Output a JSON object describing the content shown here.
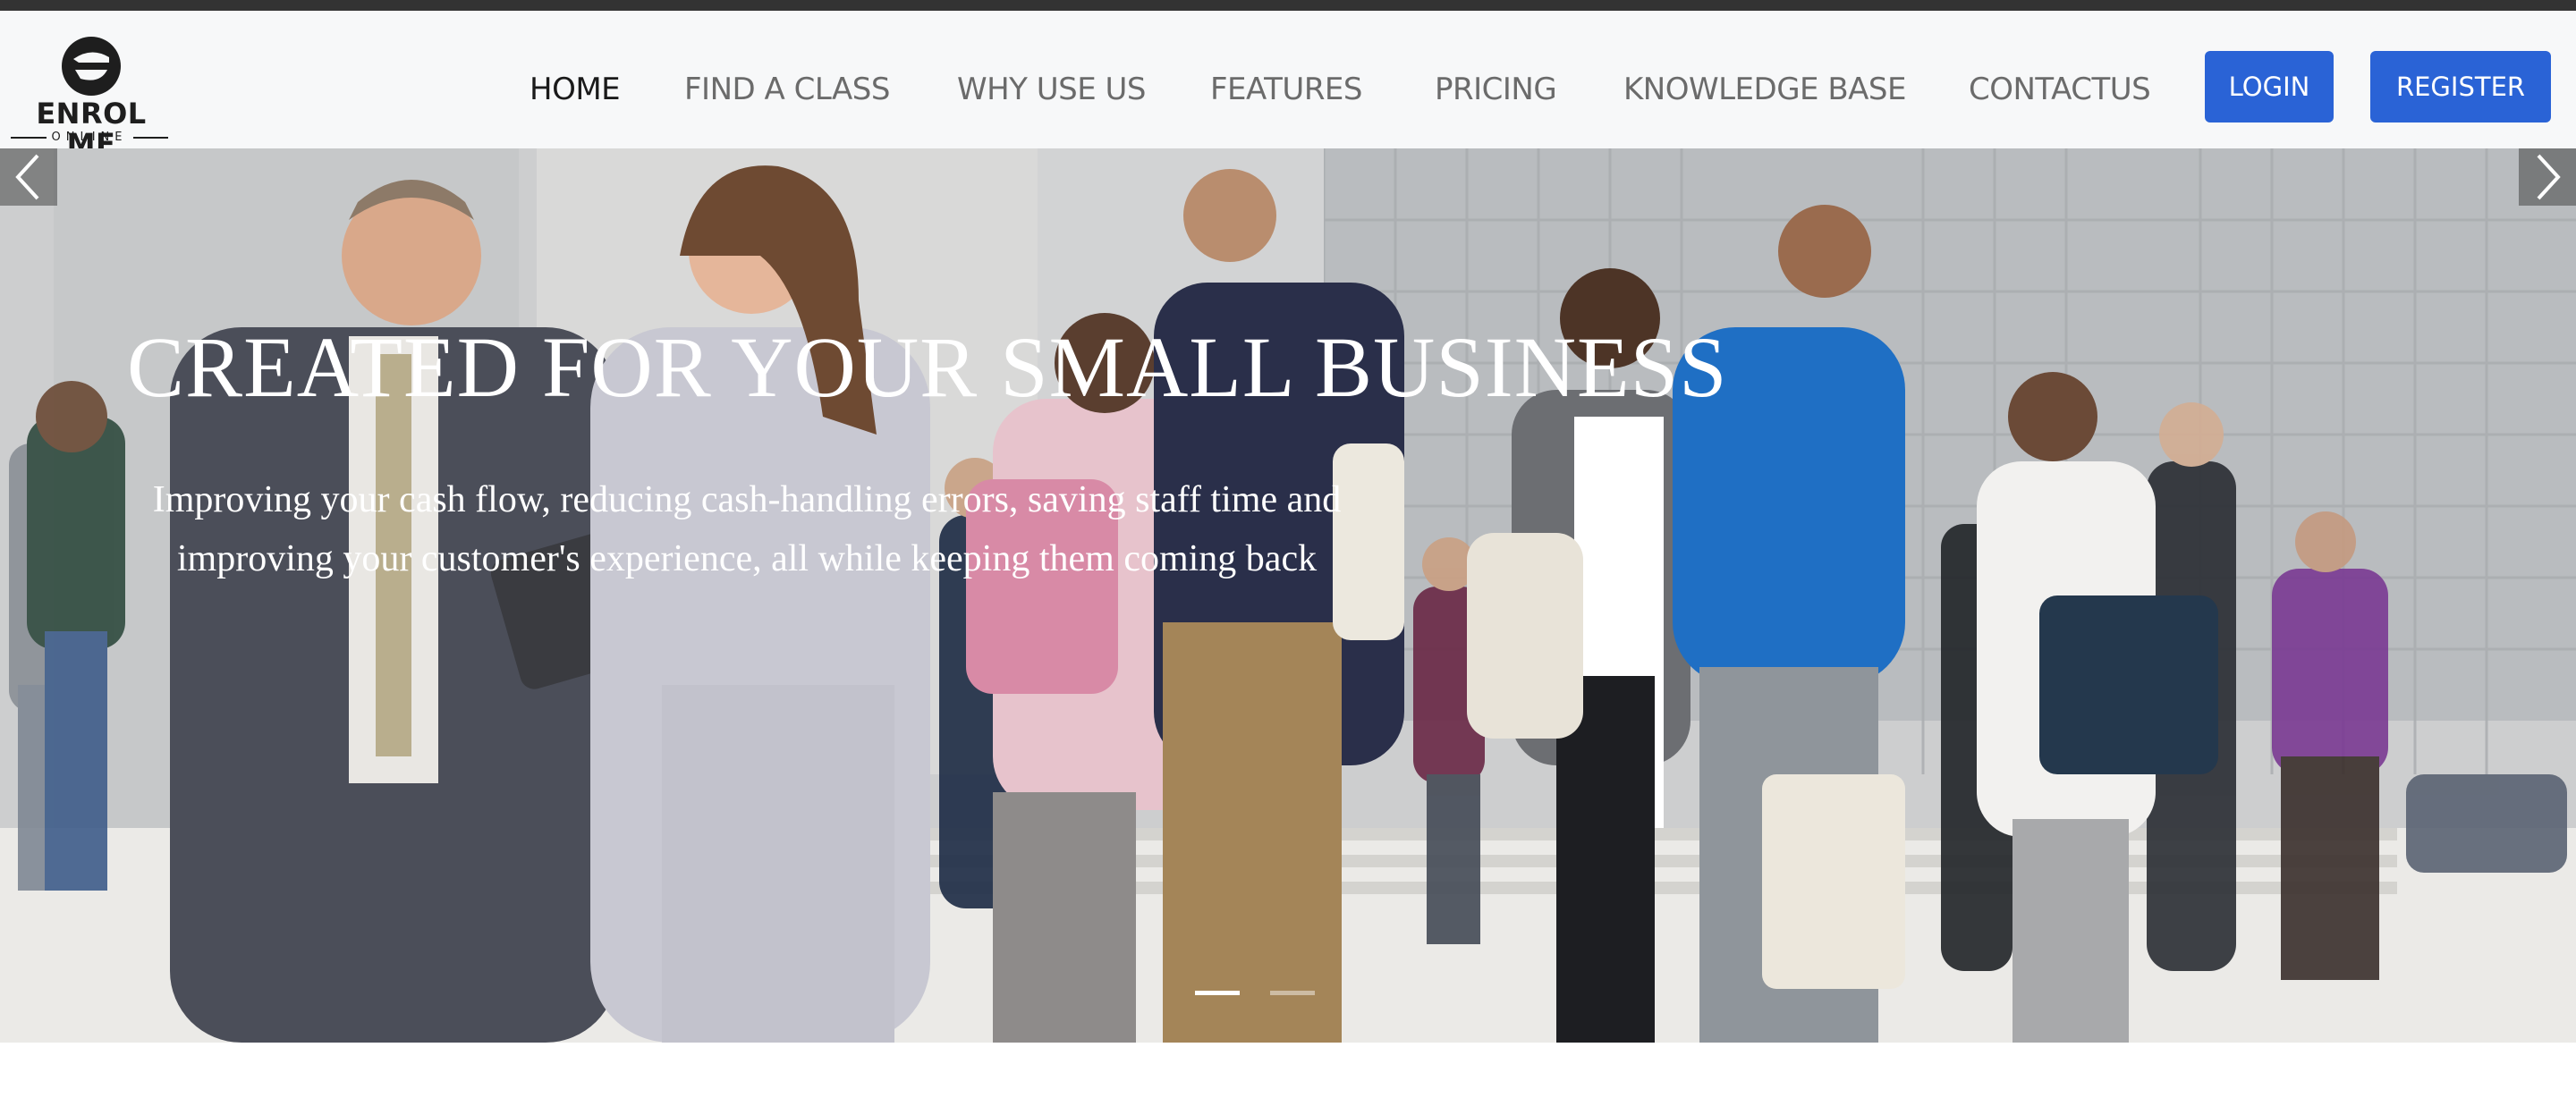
{
  "brand": {
    "name": "ENROL ME",
    "tagline": "ONLINE",
    "logo_icon": "e-monogram-icon"
  },
  "nav": {
    "items": [
      {
        "label": "HOME",
        "active": true
      },
      {
        "label": "FIND A CLASS",
        "active": false
      },
      {
        "label": "WHY USE US",
        "active": false
      },
      {
        "label": "FEATURES",
        "active": false
      },
      {
        "label": "PRICING",
        "active": false
      },
      {
        "label": "KNOWLEDGE BASE",
        "active": false
      },
      {
        "label": "CONTACTUS",
        "active": false
      }
    ],
    "login_label": "LOGIN",
    "register_label": "REGISTER"
  },
  "hero": {
    "title": "CREATED FOR YOUR SMALL BUSINESS",
    "subtitle": "Improving your cash flow, reducing cash-handling errors, saving staff time and improving your customer's experience, all while keeping them coming back",
    "prev_icon": "chevron-left-icon",
    "next_icon": "chevron-right-icon",
    "slide_count": 2,
    "active_slide": 1
  },
  "colors": {
    "accent": "#2a63d6",
    "topbar": "#333333",
    "header_bg": "#f7f8f9",
    "nav_text": "#6b6b6b",
    "nav_active": "#1a1a1a"
  }
}
